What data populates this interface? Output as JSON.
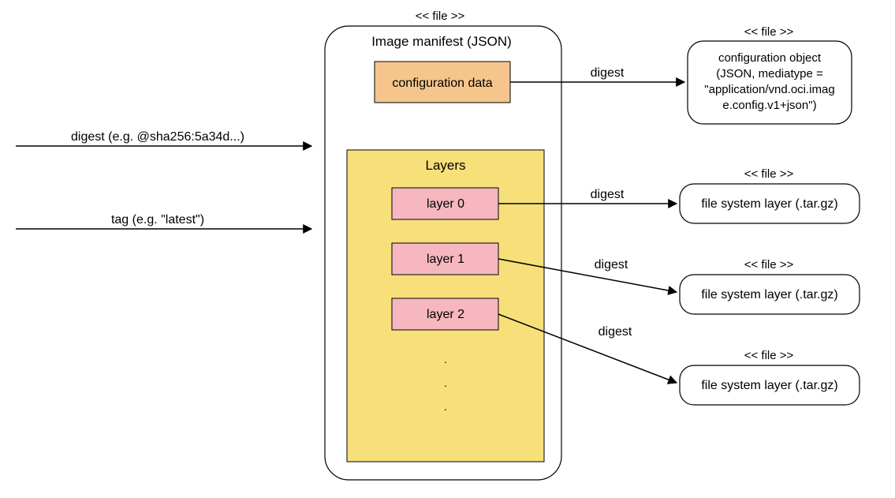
{
  "stereotypes": {
    "file": "<< file >>"
  },
  "manifest": {
    "title": "Image manifest (JSON)",
    "config_box": "configuration data",
    "layers_title": "Layers",
    "layers": [
      "layer 0",
      "layer 1",
      "layer 2"
    ],
    "ellipsis": ". . ."
  },
  "incoming": {
    "digest_label": "digest (e.g. @sha256:5a34d...)",
    "tag_label": "tag (e.g. \"latest\")"
  },
  "edge_label": "digest",
  "config_object": {
    "line1": "configuration object",
    "line2": "(JSON, mediatype =",
    "line3": "\"application/vnd.oci.imag",
    "line4": "e.config.v1+json\")"
  },
  "fs_layer_label": "file system layer (.tar.gz)"
}
